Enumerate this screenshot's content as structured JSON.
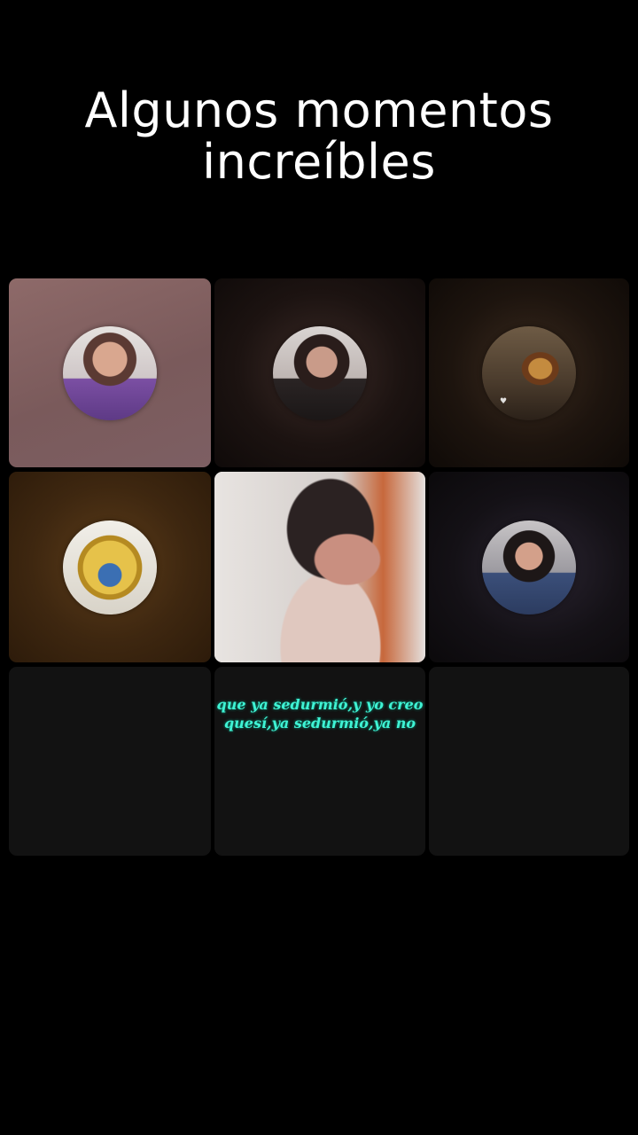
{
  "header": {
    "title_line1": "Algunos momentos",
    "title_line2": "increíbles"
  },
  "grid": {
    "tiles": [
      {
        "id": 1,
        "kind": "participant",
        "avatar_icon": "user-avatar-icon"
      },
      {
        "id": 2,
        "kind": "participant",
        "avatar_icon": "user-avatar-icon"
      },
      {
        "id": 3,
        "kind": "participant",
        "avatar_icon": "user-avatar-icon"
      },
      {
        "id": 4,
        "kind": "participant",
        "avatar_icon": "user-avatar-icon"
      },
      {
        "id": 5,
        "kind": "video-stream"
      },
      {
        "id": 6,
        "kind": "participant",
        "avatar_icon": "user-avatar-icon"
      },
      {
        "id": 7,
        "kind": "empty"
      },
      {
        "id": 8,
        "kind": "empty-with-caption"
      },
      {
        "id": 9,
        "kind": "empty"
      }
    ],
    "caption_line1": "que ya sedurmió,y yo creo",
    "caption_line2": "quesí,ya sedurmió,ya no"
  },
  "colors": {
    "background": "#000000",
    "title": "#ffffff",
    "caption": "#3ff3d4",
    "empty_tile": "#121212"
  }
}
